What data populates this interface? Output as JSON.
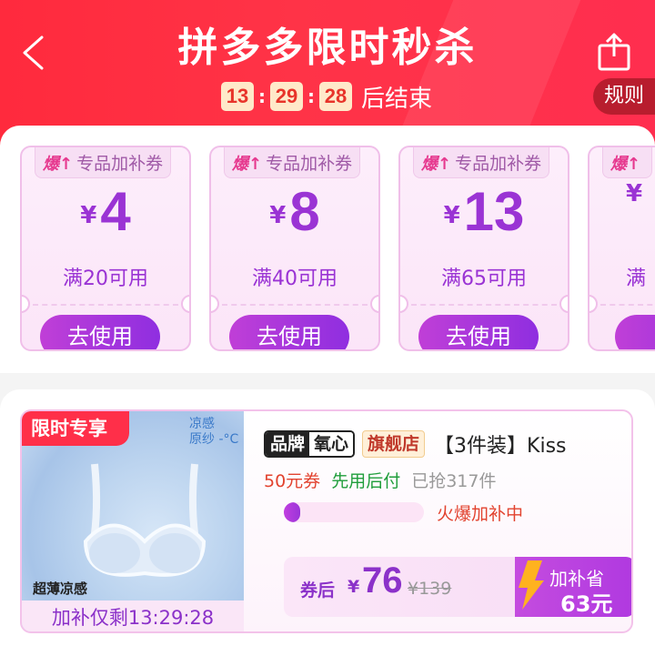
{
  "header": {
    "title": "拼多多限时秒杀",
    "countdown": {
      "hours": "13",
      "minutes": "29",
      "seconds": "28",
      "suffix": "后结束"
    },
    "rules_label": "规则"
  },
  "coupons": [
    {
      "tag_prefix": "爆↑",
      "tag": "专品加补券",
      "currency": "¥",
      "amount": "4",
      "condition": "满20可用",
      "button": "去使用"
    },
    {
      "tag_prefix": "爆↑",
      "tag": "专品加补券",
      "currency": "¥",
      "amount": "8",
      "condition": "满40可用",
      "button": "去使用"
    },
    {
      "tag_prefix": "爆↑",
      "tag": "专品加补券",
      "currency": "¥",
      "amount": "13",
      "condition": "满65可用",
      "button": "去使用"
    },
    {
      "tag_prefix": "爆↑",
      "tag": "",
      "currency": "¥",
      "amount": "",
      "condition": "满",
      "button": ""
    }
  ],
  "product": {
    "badge": "限时专享",
    "cool_label_1": "凉感",
    "cool_label_2": "原纱 -°C",
    "thin_label": "超薄凉感",
    "img_countdown": "加补仅剩13:29:28",
    "brand_a": "品牌",
    "brand_b": "氧心",
    "flagship": "旗舰店",
    "title": "【3件装】Kiss",
    "coupon_text": "50元券",
    "pay_text": "先用后付",
    "sold_text": "已抢317件",
    "progress_fraction": 0.08,
    "progress_text": "火爆加补中",
    "price_prefix": "券后",
    "price_currency": "¥",
    "price_now": "76",
    "price_original": "¥139",
    "save_label": "加补省",
    "save_value": "63元"
  },
  "colors": {
    "header_red": "#ff2a3d",
    "purple": "#9a33d4",
    "badge_red": "#ff2f49"
  }
}
